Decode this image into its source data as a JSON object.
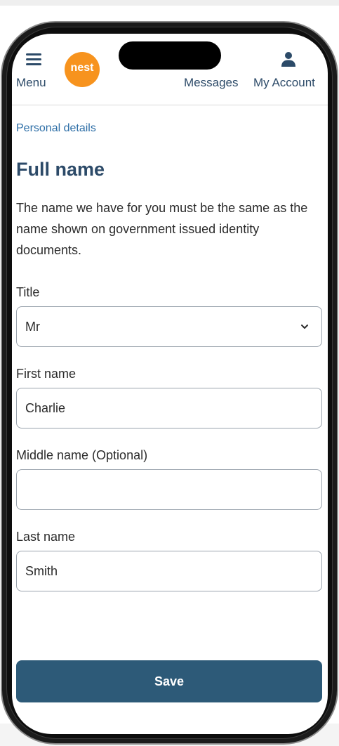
{
  "header": {
    "menu_label": "Menu",
    "logo_text": "nest",
    "messages_label": "Messages",
    "account_label": "My Account"
  },
  "breadcrumb": "Personal details",
  "page_title": "Full name",
  "intro": "The name we have for you must be the same as the name shown on government issued identity documents.",
  "form": {
    "title": {
      "label": "Title",
      "value": "Mr"
    },
    "first_name": {
      "label": "First name",
      "value": "Charlie"
    },
    "middle_name": {
      "label": "Middle name (Optional)",
      "value": ""
    },
    "last_name": {
      "label": "Last name",
      "value": "Smith"
    }
  },
  "save_label": "Save",
  "colors": {
    "brand_navy": "#2c4a68",
    "button": "#2d5a78",
    "link": "#2e6fa7",
    "logo_orange": "#f7931e"
  }
}
